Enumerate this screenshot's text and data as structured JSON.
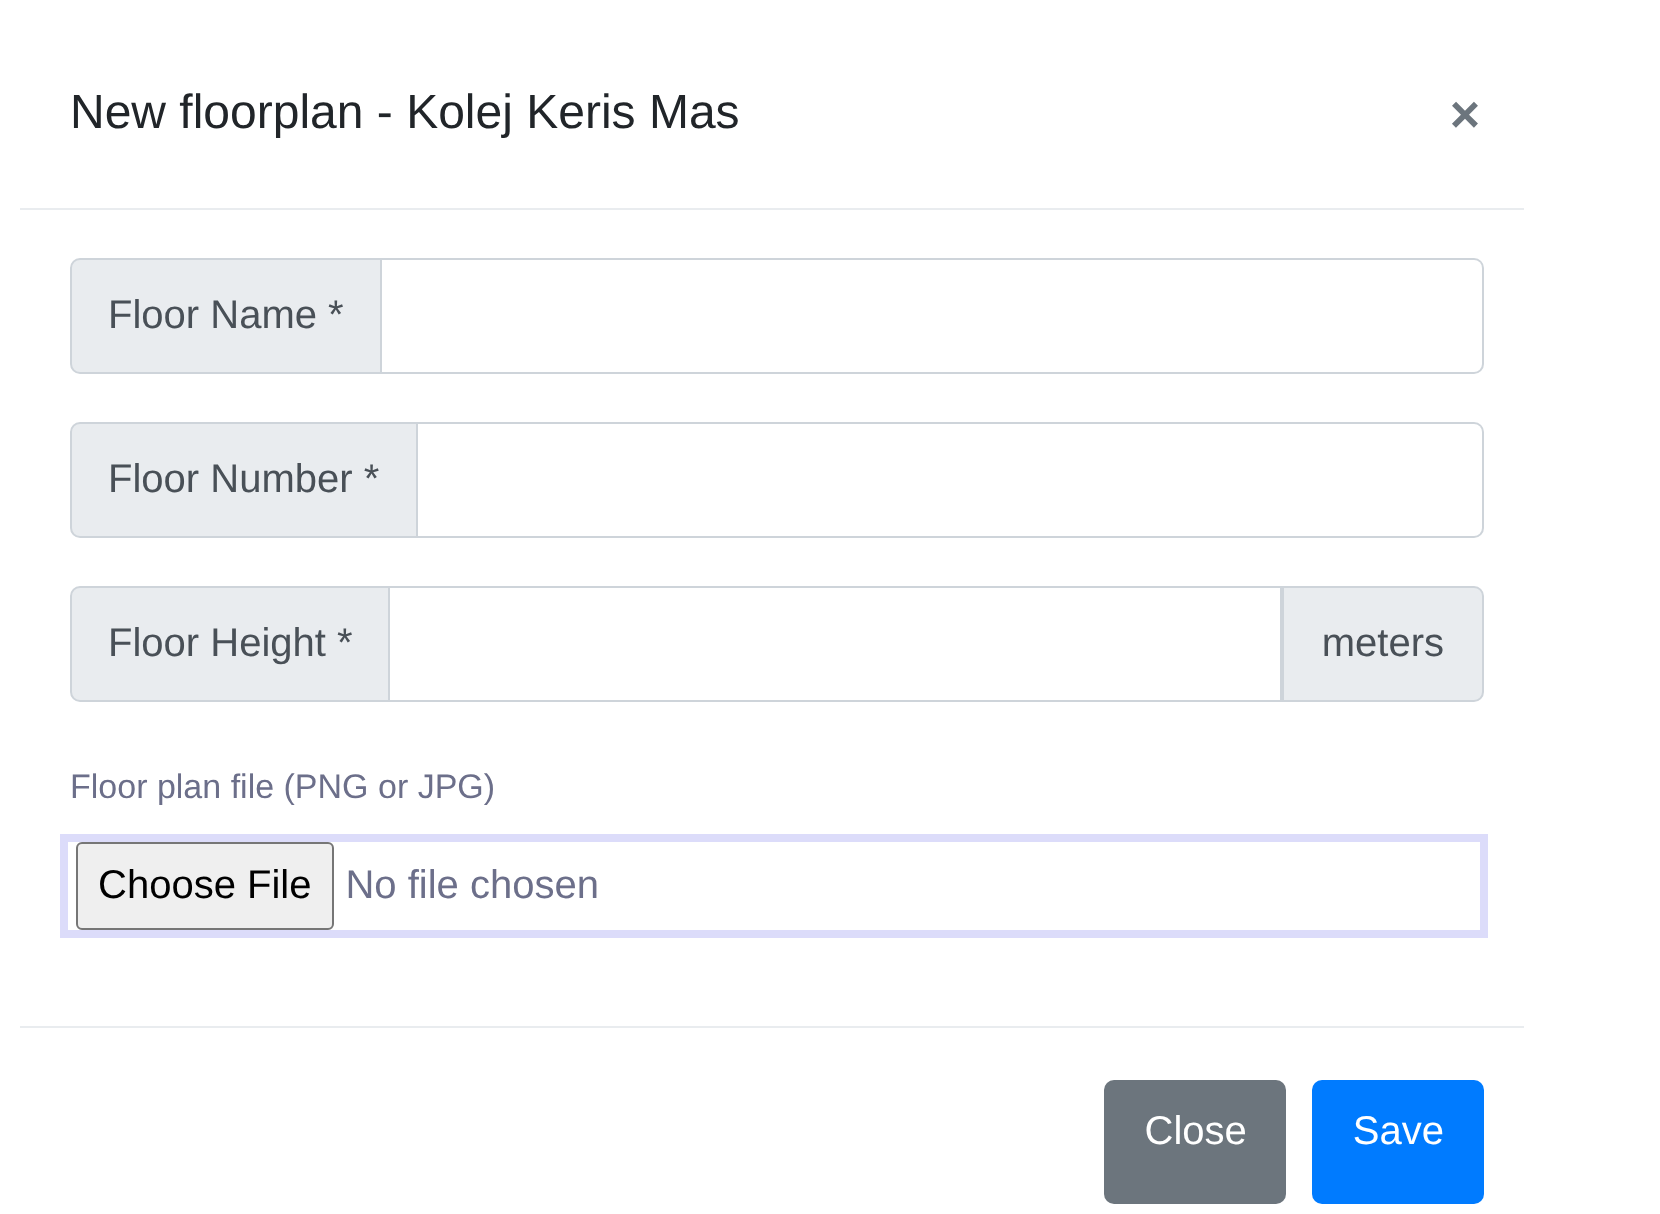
{
  "modal": {
    "title": "New floorplan - Kolej Keris Mas",
    "close_icon": "×"
  },
  "fields": [
    {
      "label": "Floor Name *"
    },
    {
      "label": "Floor Number *"
    },
    {
      "label": "Floor Height *",
      "suffix": "meters"
    }
  ],
  "file_field": {
    "label": "Floor plan file (PNG or JPG)",
    "button": "Choose File",
    "status": "No file chosen",
    "focused": true
  },
  "buttons": [
    {
      "label": "Close",
      "kind": "secondary"
    },
    {
      "label": "Save",
      "kind": "primary"
    }
  ]
}
